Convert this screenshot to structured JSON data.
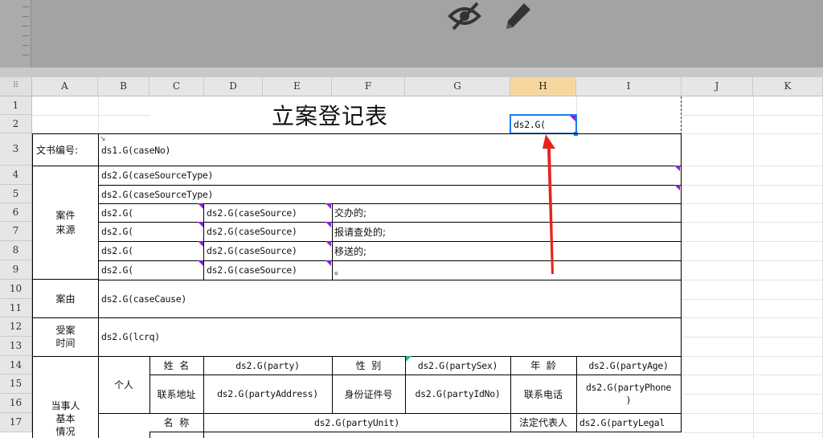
{
  "toolbar": {
    "icons": [
      "eye-off-icon",
      "pencil-icon"
    ]
  },
  "grid": {
    "columns": [
      "A",
      "B",
      "C",
      "D",
      "E",
      "F",
      "G",
      "H",
      "I",
      "J",
      "K"
    ],
    "selected_column": "H",
    "rows": [
      "1",
      "2",
      "3",
      "4",
      "5",
      "6",
      "7",
      "8",
      "9",
      "10",
      "11",
      "12",
      "13",
      "14",
      "15",
      "16",
      "17"
    ]
  },
  "sheet": {
    "title": "立案登记表",
    "selected_cell_value": "ds2.G(",
    "doc_no_label": "文书编号:",
    "doc_no_value": "ds1.G(caseNo)",
    "case_source_label": "案件\n来源",
    "case_source_type_1": "ds2.G(caseSourceType)",
    "case_source_type_2": "ds2.G(caseSourceType)",
    "source_rows": [
      {
        "prefix": "ds2.G(",
        "source": "ds2.G(caseSource)",
        "text": "交办的;"
      },
      {
        "prefix": "ds2.G(",
        "source": "ds2.G(caseSource)",
        "text": "报请查处的;"
      },
      {
        "prefix": "ds2.G(",
        "source": "ds2.G(caseSource)",
        "text": "移送的;"
      },
      {
        "prefix": "ds2.G(",
        "source": "ds2.G(caseSource)",
        "text": "。"
      }
    ],
    "cause_label": "案由",
    "cause_value": "ds2.G(caseCause)",
    "accept_time_label": "受案\n时间",
    "accept_time_value": "ds2.G(lcrq)",
    "party_label": "当事人\n基本\n情况",
    "individual_label": "个人",
    "name_label": "姓  名",
    "name_value": "ds2.G(party)",
    "sex_label": "性  别",
    "sex_value": "ds2.G(partySex)",
    "age_label": "年  龄",
    "age_value": "ds2.G(partyAge)",
    "address_label": "联系地址",
    "address_value": "ds2.G(partyAddress)",
    "id_label": "身份证件号",
    "id_value": "ds2.G(partyIdNo)",
    "phone_label": "联系电话",
    "phone_value": "ds2.G(partyPhone\n)",
    "unit_name_label": "名  称",
    "unit_value": "ds2.G(partyUnit)",
    "legal_rep_label": "法定代表人",
    "legal_rep_value": "ds2.G(partyLegal"
  },
  "colors": {
    "accent": "#1e7be8",
    "marker": "#8a1fd1",
    "arrow": "#e8231d"
  }
}
